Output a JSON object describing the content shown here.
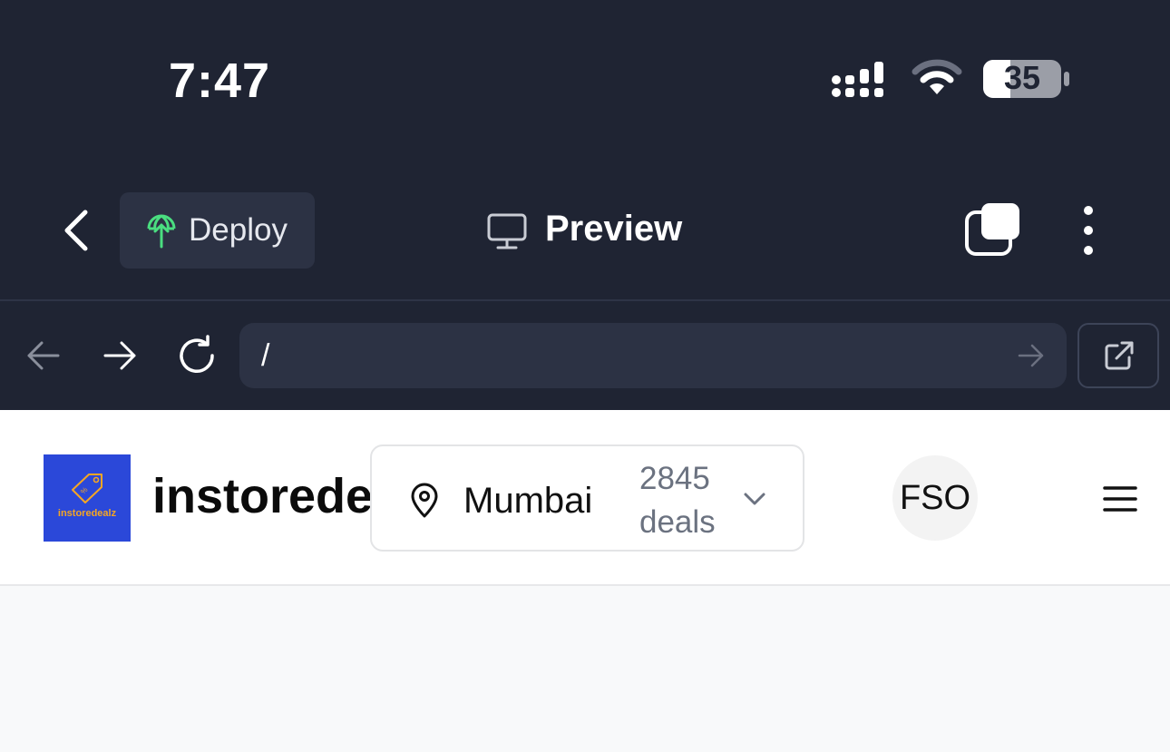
{
  "status_bar": {
    "time": "7:47",
    "battery_level": "35"
  },
  "toolbar": {
    "deploy_label": "Deploy",
    "preview_label": "Preview"
  },
  "browser": {
    "url": "/"
  },
  "site": {
    "logo_text": "instoredealz",
    "brand": "instoredealz",
    "city": "Mumbai",
    "deal_count": "2845",
    "deal_word": "deals",
    "avatar_initials": "FSO"
  },
  "colors": {
    "chrome_bg": "#1f2433",
    "control_bg": "#2c3244",
    "deploy_accent": "#4ade80",
    "logo_bg": "#2b48d9",
    "logo_text": "#f5a623"
  }
}
